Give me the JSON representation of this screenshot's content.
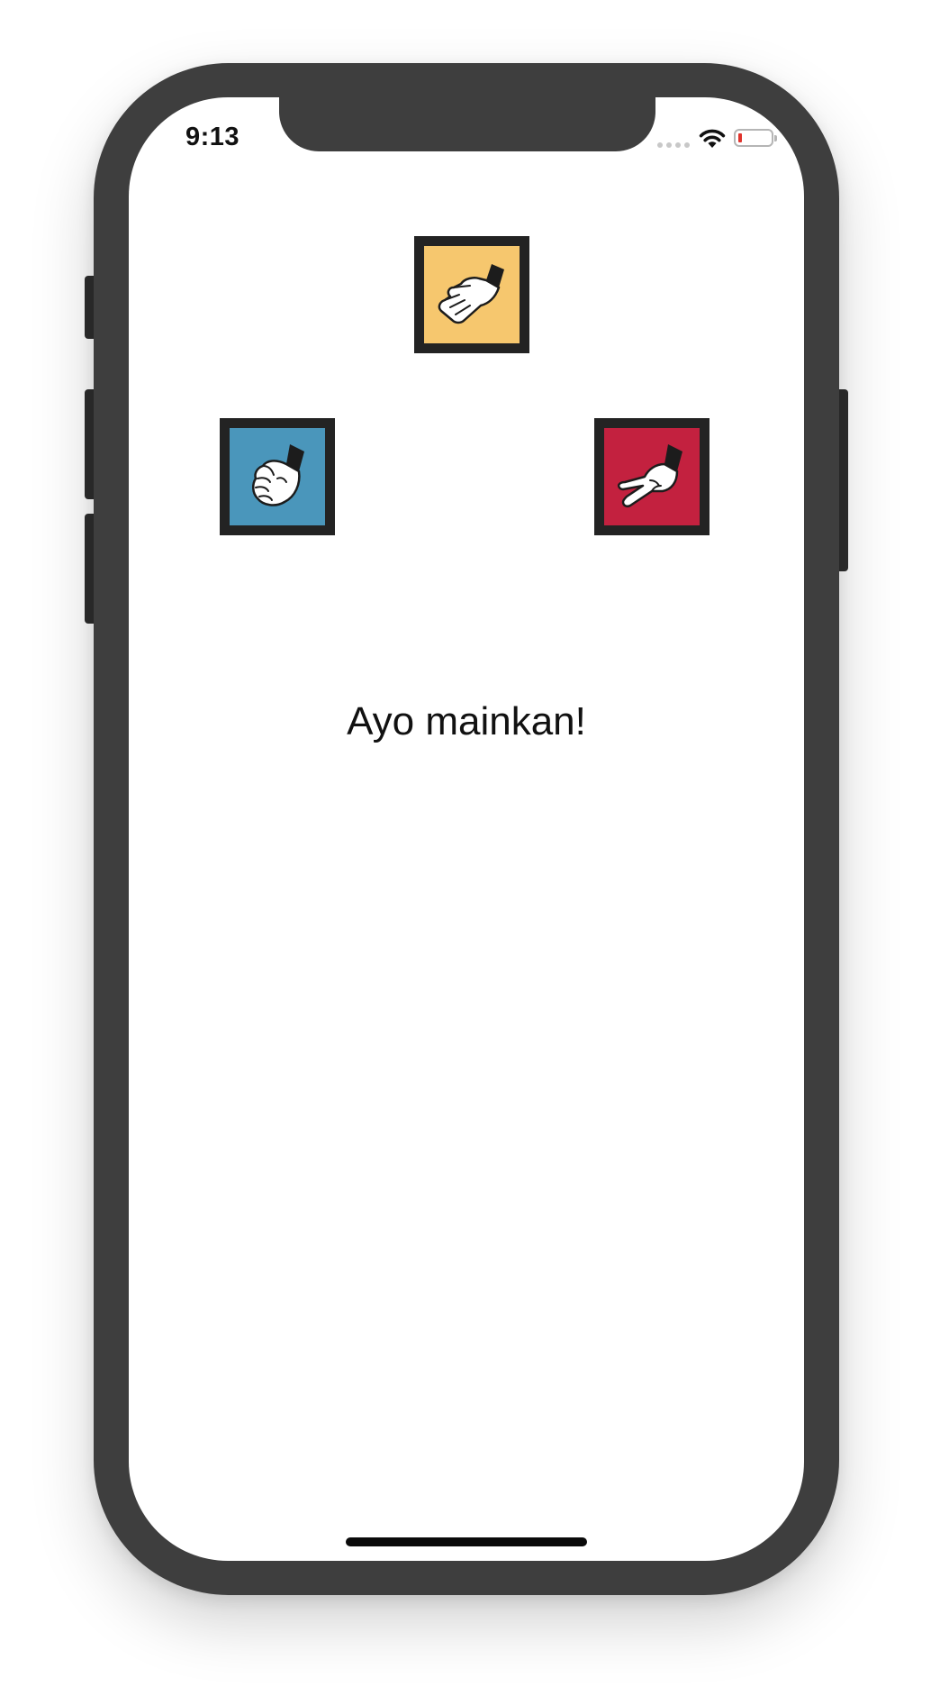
{
  "status_bar": {
    "time": "9:13",
    "icons": [
      "cellular-signal-icon",
      "wifi-icon",
      "battery-low-icon"
    ],
    "battery_level_color": "#e0342d"
  },
  "game": {
    "choices": [
      {
        "id": "paper",
        "icon": "open-hand-icon",
        "background": "#f6c76e"
      },
      {
        "id": "rock",
        "icon": "fist-icon",
        "background": "#4a96bb"
      },
      {
        "id": "scissors",
        "icon": "two-fingers-icon",
        "background": "#c3213f"
      }
    ],
    "message": "Ayo mainkan!"
  },
  "colors": {
    "device_frame": "#3e3e3e",
    "tile_border": "#232323",
    "text": "#111111"
  }
}
